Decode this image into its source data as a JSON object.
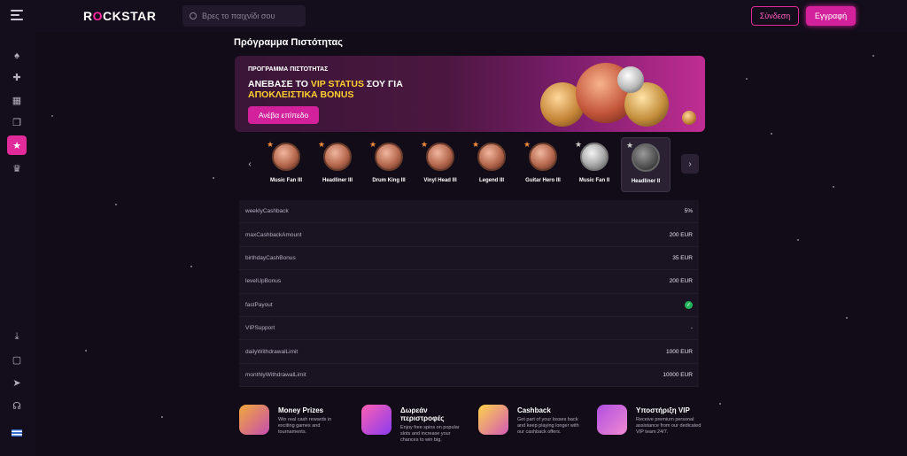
{
  "header": {
    "logo": "ROCKSTAR",
    "search_placeholder": "Βρες το παιχνίδι σου",
    "login_label": "Σύνδεση",
    "register_label": "Εγγραφή"
  },
  "sidebar": {
    "top_items": [
      "spade-icon",
      "puzzle-icon",
      "grid-icon",
      "gift-icon",
      "star-icon",
      "trophy-icon"
    ],
    "bottom_items": [
      "download-icon",
      "square-icon",
      "telegram-icon",
      "headset-icon",
      "flag-gr-icon"
    ],
    "active": "star-icon"
  },
  "page": {
    "title": "Πρόγραμμα Πιστότητας"
  },
  "banner": {
    "kicker": "ΠΡΟΓΡΑΜΜΑ ΠΙΣΤΟΤΗΤΑΣ",
    "headline_pre": "ΑΝΕΒΑΣΕ ΤΟ ",
    "headline_hl": "VIP STATUS",
    "headline_mid": " ΣΟΥ ΓΙΑ",
    "headline_line2": "ΑΠΟΚΛΕΙΣΤΙΚΑ BONUS",
    "button": "Ανέβα επίπεδο"
  },
  "levels": [
    {
      "name": "Music Fan III",
      "tier": "bronze"
    },
    {
      "name": "Headliner III",
      "tier": "bronze"
    },
    {
      "name": "Drum King III",
      "tier": "bronze"
    },
    {
      "name": "Vinyl Head III",
      "tier": "bronze"
    },
    {
      "name": "Legend III",
      "tier": "bronze"
    },
    {
      "name": "Guitar Hero III",
      "tier": "bronze"
    },
    {
      "name": "Music Fan II",
      "tier": "silver"
    },
    {
      "name": "Headliner II",
      "tier": "silver"
    }
  ],
  "selected_level": "Headliner II",
  "table": [
    {
      "key": "weeklyCashback",
      "value": "5%"
    },
    {
      "key": "maxCashbackAmount",
      "value": "200 EUR"
    },
    {
      "key": "birthdayCashBonus",
      "value": "35 EUR"
    },
    {
      "key": "levelUpBonus",
      "value": "200 EUR"
    },
    {
      "key": "fastPayout",
      "value": "check"
    },
    {
      "key": "VIPSupport",
      "value": "-"
    },
    {
      "key": "dailyWithdrawalLimit",
      "value": "1000 EUR"
    },
    {
      "key": "monthlyWithdrawalLimit",
      "value": "10000 EUR"
    }
  ],
  "features": [
    {
      "title": "Money Prizes",
      "desc": "Win real cash rewards in exciting games and tournaments."
    },
    {
      "title": "Δωρεάν\nπεριστροφές",
      "desc": "Enjoy free spins on popular slots and increase your chances to win big."
    },
    {
      "title": "Cashback",
      "desc": "Get part of your losses back and keep playing longer with our cashback offers."
    },
    {
      "title": "Υποστήριξη VIP",
      "desc": "Receive premium personal assistance from our dedicated VIP team 24/7."
    }
  ],
  "colors": {
    "accent": "#d2219a",
    "bg": "#120c18",
    "panel": "#1a1322",
    "success": "#23b35a",
    "highlight": "#ffd02c"
  }
}
